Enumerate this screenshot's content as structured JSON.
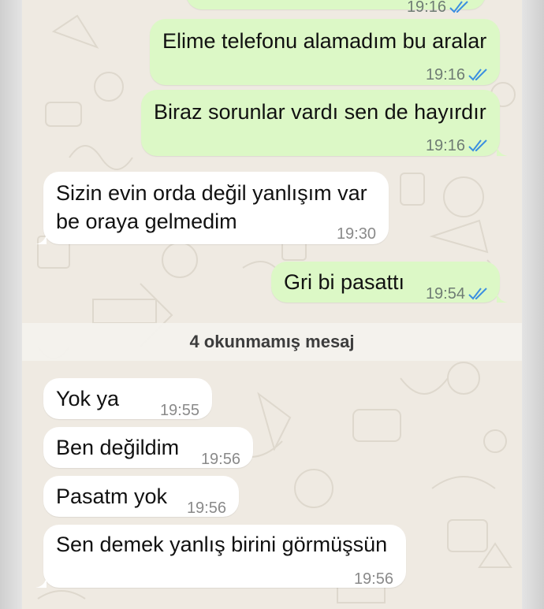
{
  "chat": {
    "top_partial": {
      "time": "19:16"
    },
    "unread_label": "4 okunmamış mesaj",
    "messages": [
      {
        "text": "Elime telefonu alamadım bu aralar",
        "time": "19:16"
      },
      {
        "text": "Biraz sorunlar vardı sen de hayırdır",
        "time": "19:16"
      },
      {
        "line1": "Sizin evin orda değil yanlışım var",
        "line2": "be oraya gelmedim",
        "time": "19:30"
      },
      {
        "text": "Gri bi pasattı",
        "time": "19:54"
      },
      {
        "text": "Yok ya",
        "time": "19:55"
      },
      {
        "text": "Ben değildim",
        "time": "19:56"
      },
      {
        "text": "Pasatm yok",
        "time": "19:56"
      },
      {
        "text": "Sen demek yanlış birini görmüşsün",
        "time": "19:56"
      }
    ]
  },
  "colors": {
    "outgoing_bubble": "#dcf8c6",
    "incoming_bubble": "#ffffff",
    "read_ticks": "#3b8fe0",
    "wallpaper": "#efeae2"
  },
  "icons": {
    "read_receipt": "double-check-icon"
  }
}
